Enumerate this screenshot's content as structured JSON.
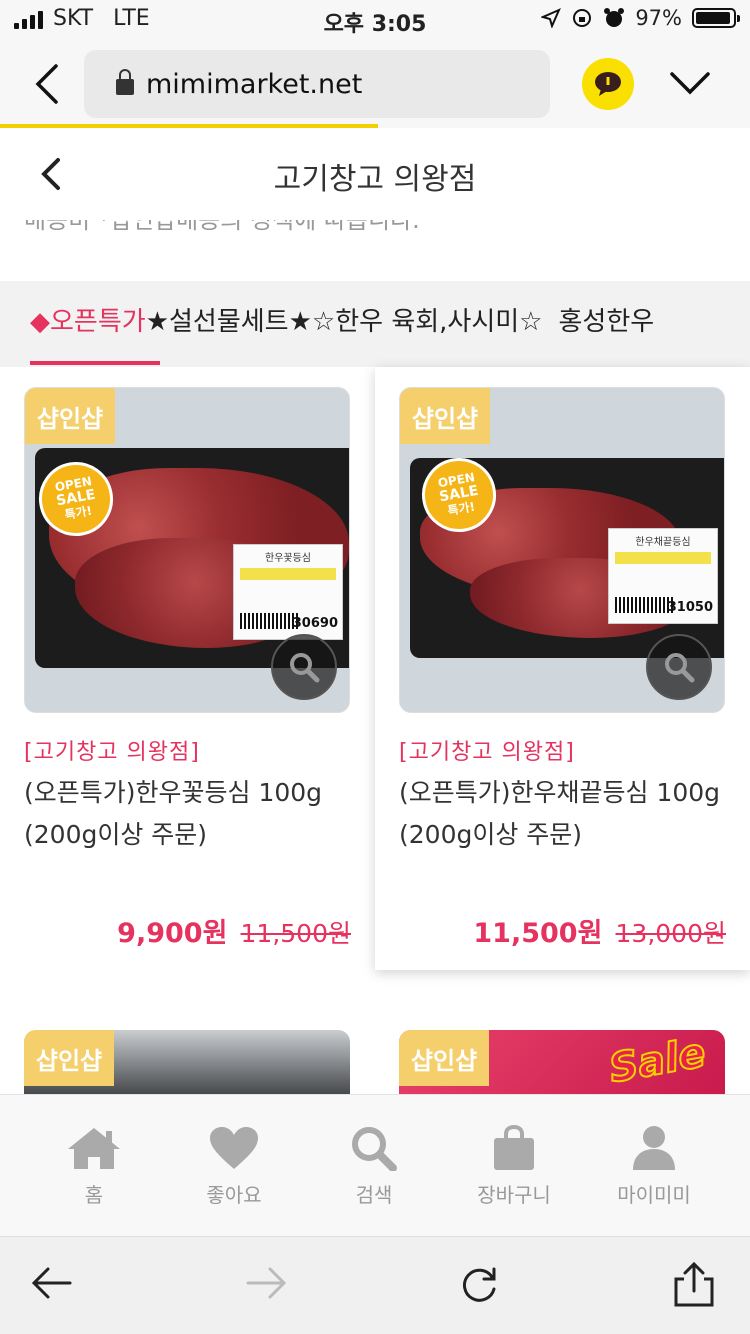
{
  "status_bar": {
    "carrier": "SKT",
    "network": "LTE",
    "time": "오후 3:05",
    "battery": "97%"
  },
  "browser": {
    "url": "mimimarket.net",
    "load_progress": 0.5
  },
  "shop_header": {
    "title": "고기창고 의왕점",
    "partial_text": "배송비 *샵인샵배송의 정책에 따릅니다."
  },
  "category_tabs": [
    {
      "label": "◆오픈특가",
      "active": true
    },
    {
      "label": "★설선물세트★",
      "active": false
    },
    {
      "label": "☆한우 육회,사시미☆",
      "active": false
    },
    {
      "label": "홍성한우",
      "active": false
    }
  ],
  "products": [
    {
      "badge": "샵인샵",
      "seller": "[고기창고 의왕점]",
      "name": "(오픈특가)한우꽃등심 100g (200g이상 주문)",
      "price": "9,900원",
      "original_price": "11,500원",
      "image": {
        "label_title": "한우꽃등심",
        "label_price": "30690",
        "sticker_top": "OPEN",
        "sticker_mid": "SALE",
        "sticker_bot": "특가!"
      }
    },
    {
      "badge": "샵인샵",
      "seller": "[고기창고 의왕점]",
      "name": "(오픈특가)한우채끝등심 100g (200g이상 주문)",
      "price": "11,500원",
      "original_price": "13,000원",
      "image": {
        "label_title": "한우채끝등심",
        "label_price": "31050",
        "sticker_top": "OPEN",
        "sticker_mid": "SALE",
        "sticker_bot": "특가!"
      }
    }
  ],
  "next_row": [
    {
      "badge": "샵인샵"
    },
    {
      "badge": "샵인샵",
      "image_text": "Sale"
    }
  ],
  "bottom_nav": [
    {
      "label": "홈",
      "icon": "home-icon"
    },
    {
      "label": "좋아요",
      "icon": "heart-icon"
    },
    {
      "label": "검색",
      "icon": "search-icon"
    },
    {
      "label": "장바구니",
      "icon": "bag-icon"
    },
    {
      "label": "마이미미",
      "icon": "person-icon"
    }
  ],
  "colors": {
    "accent": "#e5325f",
    "badge": "#f5cf6b",
    "kakao": "#f9e000"
  }
}
